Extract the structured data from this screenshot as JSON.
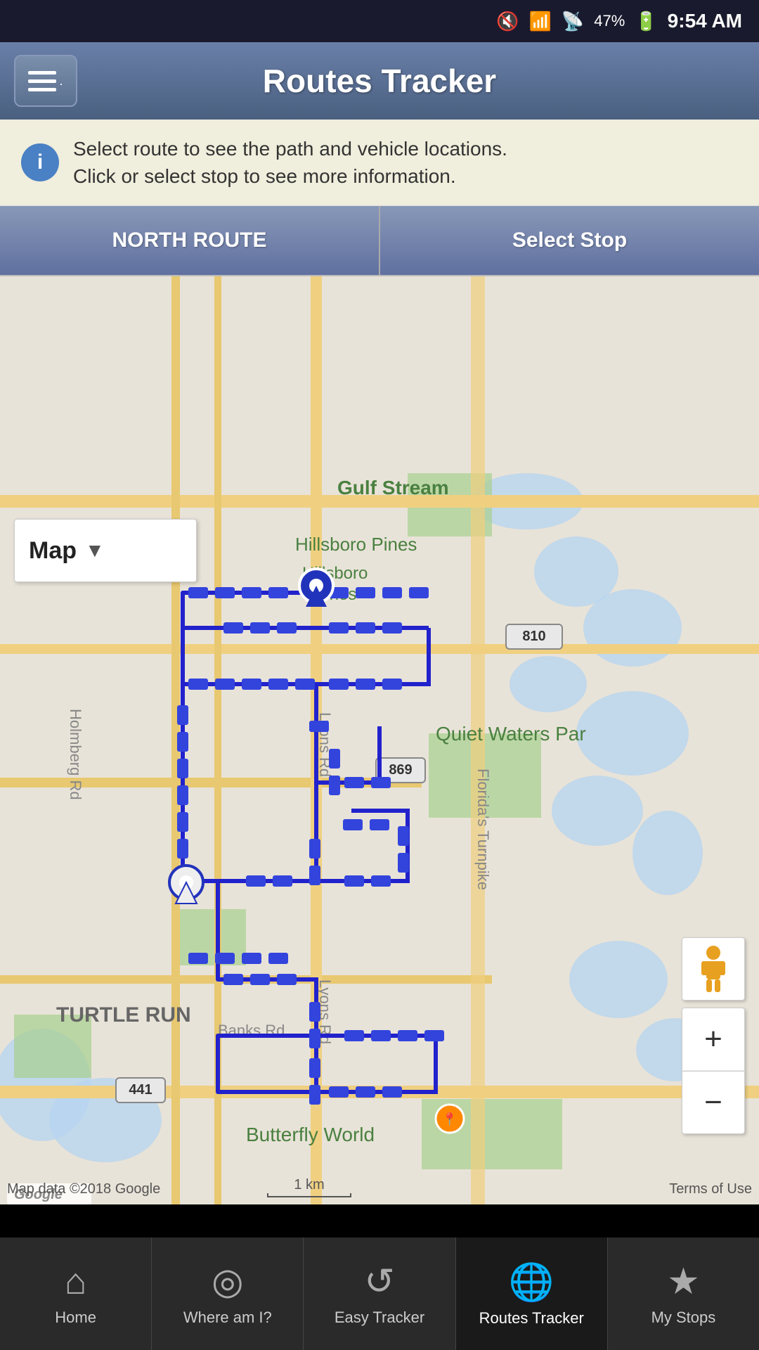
{
  "statusBar": {
    "battery": "47%",
    "time": "9:54 AM"
  },
  "header": {
    "title": "Routes Tracker",
    "menuLabel": "Menu"
  },
  "infoBanner": {
    "text": "Select route to see the path and vehicle locations.\nClick or select stop to see more information."
  },
  "routeSelector": {
    "northRouteLabel": "NORTH ROUTE",
    "selectStopLabel": "Select Stop"
  },
  "mapType": {
    "label": "Map",
    "dropdownArrow": "▼"
  },
  "mapControls": {
    "zoomIn": "+",
    "zoomOut": "−"
  },
  "mapAttribution": {
    "google": "Google",
    "dataLabel": "Map data ©2018 Google",
    "scaleLabel": "1 km",
    "terms": "Terms of Use"
  },
  "bottomNav": {
    "items": [
      {
        "id": "home",
        "label": "Home",
        "icon": "⌂",
        "active": false
      },
      {
        "id": "where-am-i",
        "label": "Where am I?",
        "icon": "◎",
        "active": false
      },
      {
        "id": "easy-tracker",
        "label": "Easy Tracker",
        "icon": "↺",
        "active": false
      },
      {
        "id": "routes-tracker",
        "label": "Routes Tracker",
        "icon": "🌐",
        "active": true
      },
      {
        "id": "my-stops",
        "label": "My Stops",
        "icon": "★",
        "active": false
      }
    ]
  }
}
